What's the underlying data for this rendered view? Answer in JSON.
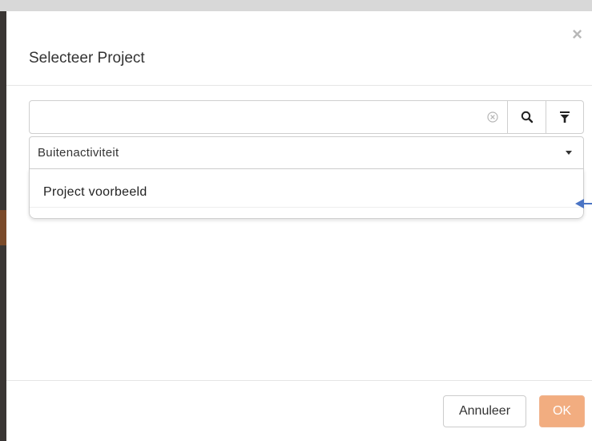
{
  "modal": {
    "title": "Selecteer Project",
    "close_label": "×"
  },
  "search": {
    "value": "",
    "placeholder": "",
    "clear_icon": "circle-x-icon",
    "search_icon": "search-icon",
    "filter_icon": "filter-icon"
  },
  "category_select": {
    "selected": "Buitenactiviteit"
  },
  "projects": [
    {
      "label": "Project voorbeeld"
    }
  ],
  "footer": {
    "cancel_label": "Annuleer",
    "ok_label": "OK"
  },
  "colors": {
    "ok_button": "#f2ad80",
    "arrow": "#4a74c4"
  }
}
